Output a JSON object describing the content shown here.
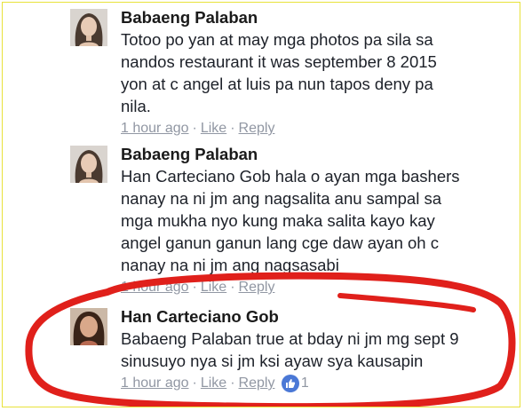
{
  "comments": [
    {
      "author": "Babaeng Palaban",
      "lines": [
        "Totoo po yan at may mga photos pa sila sa",
        "nandos restaurant it was september 8 2015",
        "yon at c angel at luis pa nun tapos deny pa",
        "nila."
      ],
      "time": "1 hour ago",
      "like": "Like",
      "reply": "Reply"
    },
    {
      "author": "Babaeng Palaban",
      "lines": [
        "Han Carteciano Gob hala o ayan mga bashers",
        "nanay na ni jm ang nagsalita anu sampal sa",
        "mga mukha nyo kung maka salita kayo kay",
        "angel ganun ganun lang cge daw ayan oh c",
        "nanay na ni jm ang nagsasabi"
      ],
      "time": "1 hour ago",
      "like": "Like",
      "reply": "Reply"
    },
    {
      "author": "Han Carteciano Gob",
      "lines": [
        "Babaeng Palaban true at bday ni jm mg sept 9",
        "sinusuyo nya si jm ksi ayaw sya kausapin"
      ],
      "time": "1 hour ago",
      "like": "Like",
      "reply": "Reply",
      "reactions": "1"
    }
  ],
  "colors": {
    "frame": "#e8e23a",
    "annotation": "#e0201b",
    "like_badge": "#4a78d6"
  }
}
